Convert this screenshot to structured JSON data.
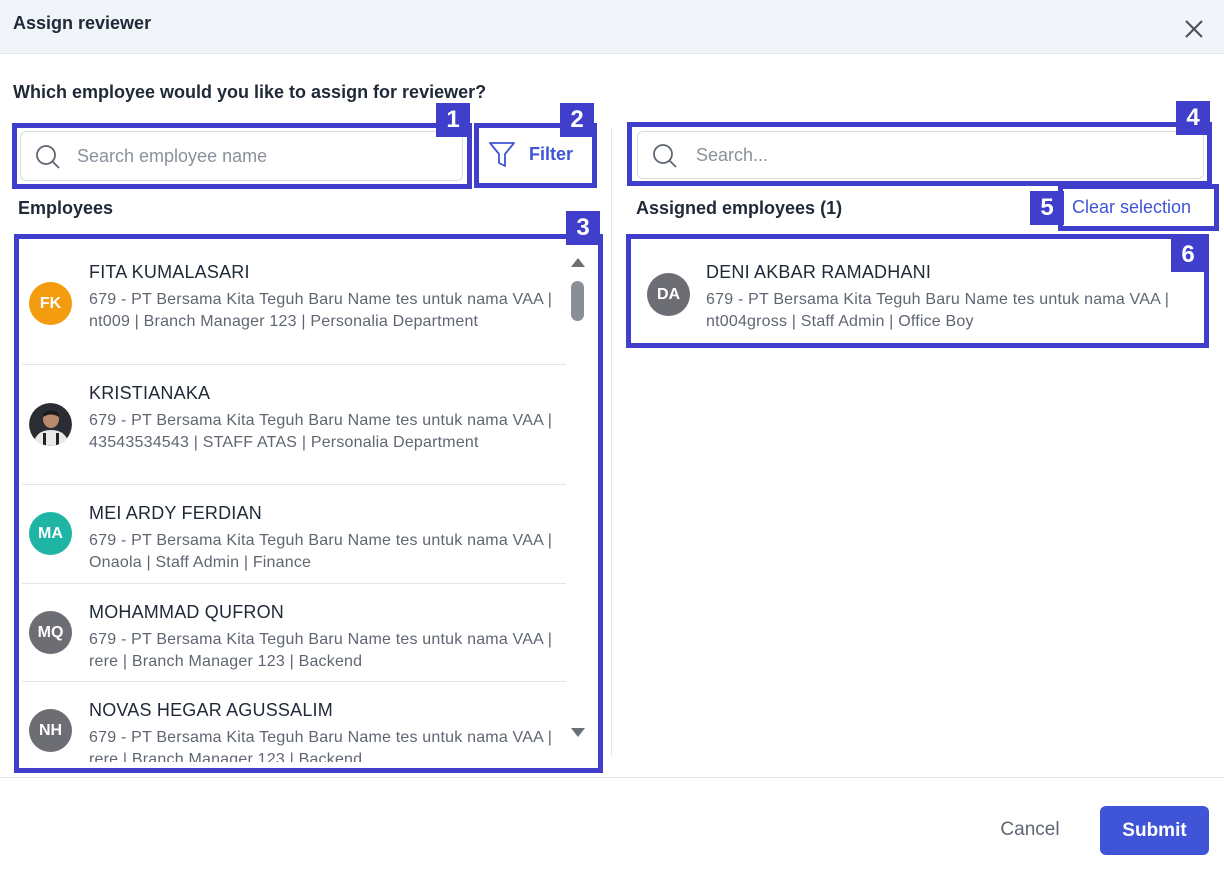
{
  "dialog": {
    "title": "Assign reviewer"
  },
  "question": "Which employee would you like to assign for reviewer?",
  "left_search": {
    "placeholder": "Search employee name"
  },
  "filter": {
    "label": "Filter"
  },
  "employees_label": "Employees",
  "employees": [
    {
      "initials": "FK",
      "avatar_color": "#f39c0f",
      "name": "FITA KUMALASARI",
      "detail": "679 - PT Bersama Kita Teguh Baru Name tes untuk nama VAA | nt009 | Branch Manager 123 | Personalia Department"
    },
    {
      "initials": "",
      "avatar_type": "photo",
      "name": "KRISTIANAKA",
      "detail": "679 - PT Bersama Kita Teguh Baru Name tes untuk nama VAA | 43543534543 | STAFF ATAS | Personalia Department"
    },
    {
      "initials": "MA",
      "avatar_color": "#1fb5a4",
      "name": "MEI ARDY FERDIAN",
      "detail": "679 - PT Bersama Kita Teguh Baru Name tes untuk nama VAA | Onaola | Staff Admin | Finance"
    },
    {
      "initials": "MQ",
      "avatar_color": "#6d6e73",
      "name": "MOHAMMAD QUFRON",
      "detail": "679 - PT Bersama Kita Teguh Baru Name tes untuk nama VAA | rere | Branch Manager 123 | Backend"
    },
    {
      "initials": "NH",
      "avatar_color": "#6d6e73",
      "name": "NOVAS HEGAR AGUSSALIM",
      "detail": "679 - PT Bersama Kita Teguh Baru Name tes untuk nama VAA | rere | Branch Manager 123 | Backend"
    }
  ],
  "right_search": {
    "placeholder": "Search..."
  },
  "assigned_label": "Assigned employees (1)",
  "clear_selection": "Clear selection",
  "assigned": [
    {
      "initials": "DA",
      "avatar_color": "#6d6e73",
      "name": "DENI AKBAR RAMADHANI",
      "detail": "679 - PT Bersama Kita Teguh Baru Name tes untuk nama VAA | nt004gross | Staff Admin | Office Boy"
    }
  ],
  "annotations": [
    "1",
    "2",
    "3",
    "4",
    "5",
    "6"
  ],
  "footer": {
    "cancel_label": "Cancel",
    "submit_label": "Submit"
  },
  "colors": {
    "accent": "#3f54d6",
    "annotation": "#3f3fcc"
  },
  "icons": {
    "close": "close-icon",
    "search": "search-icon",
    "filter": "filter-icon"
  }
}
